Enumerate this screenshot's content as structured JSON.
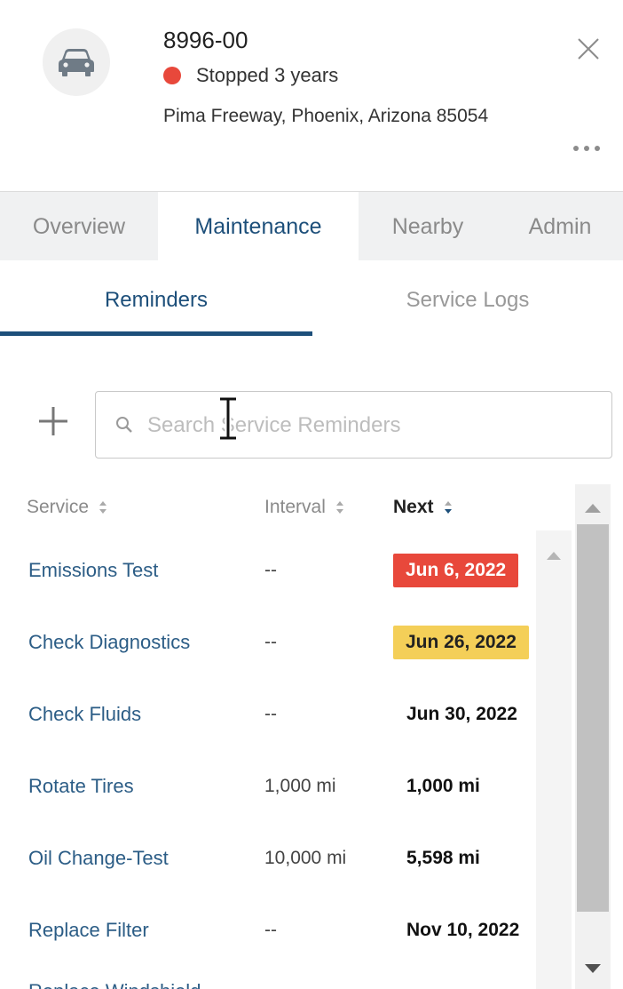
{
  "vehicle": {
    "name": "8996-00",
    "status": "Stopped 3 years",
    "status_color": "#e8483b",
    "address": "Pima Freeway, Phoenix, Arizona 85054"
  },
  "main_tabs": [
    {
      "label": "Overview",
      "active": false
    },
    {
      "label": "Maintenance",
      "active": true
    },
    {
      "label": "Nearby",
      "active": false
    },
    {
      "label": "Admin",
      "active": false
    }
  ],
  "sub_tabs": [
    {
      "label": "Reminders",
      "active": true
    },
    {
      "label": "Service Logs",
      "active": false
    }
  ],
  "search": {
    "placeholder": "Search Service Reminders",
    "value": ""
  },
  "table": {
    "columns": {
      "service": "Service",
      "interval": "Interval",
      "next": "Next"
    },
    "sorted_by": "Next",
    "rows": [
      {
        "service": "Emissions Test",
        "interval": "--",
        "next": "Jun 6, 2022",
        "badge": "red"
      },
      {
        "service": "Check Diagnostics",
        "interval": "--",
        "next": "Jun 26, 2022",
        "badge": "yellow"
      },
      {
        "service": "Check Fluids",
        "interval": "--",
        "next": "Jun 30, 2022",
        "badge": ""
      },
      {
        "service": "Rotate Tires",
        "interval": "1,000 mi",
        "next": "1,000 mi",
        "badge": ""
      },
      {
        "service": "Oil Change-Test",
        "interval": "10,000 mi",
        "next": "5,598 mi",
        "badge": ""
      },
      {
        "service": "Replace Filter",
        "interval": "--",
        "next": "Nov 10, 2022",
        "badge": ""
      },
      {
        "service": "Replace Windshield",
        "interval": "",
        "next": "",
        "badge": ""
      }
    ]
  },
  "colors": {
    "accent": "#1d4f7a",
    "link": "#2c5d86",
    "overdue": "#e8483b",
    "due_soon": "#f4cf58"
  },
  "icons": {
    "avatar": "car-icon",
    "close": "close-icon",
    "more": "more-options-icon",
    "add": "plus-icon",
    "search": "search-icon"
  }
}
